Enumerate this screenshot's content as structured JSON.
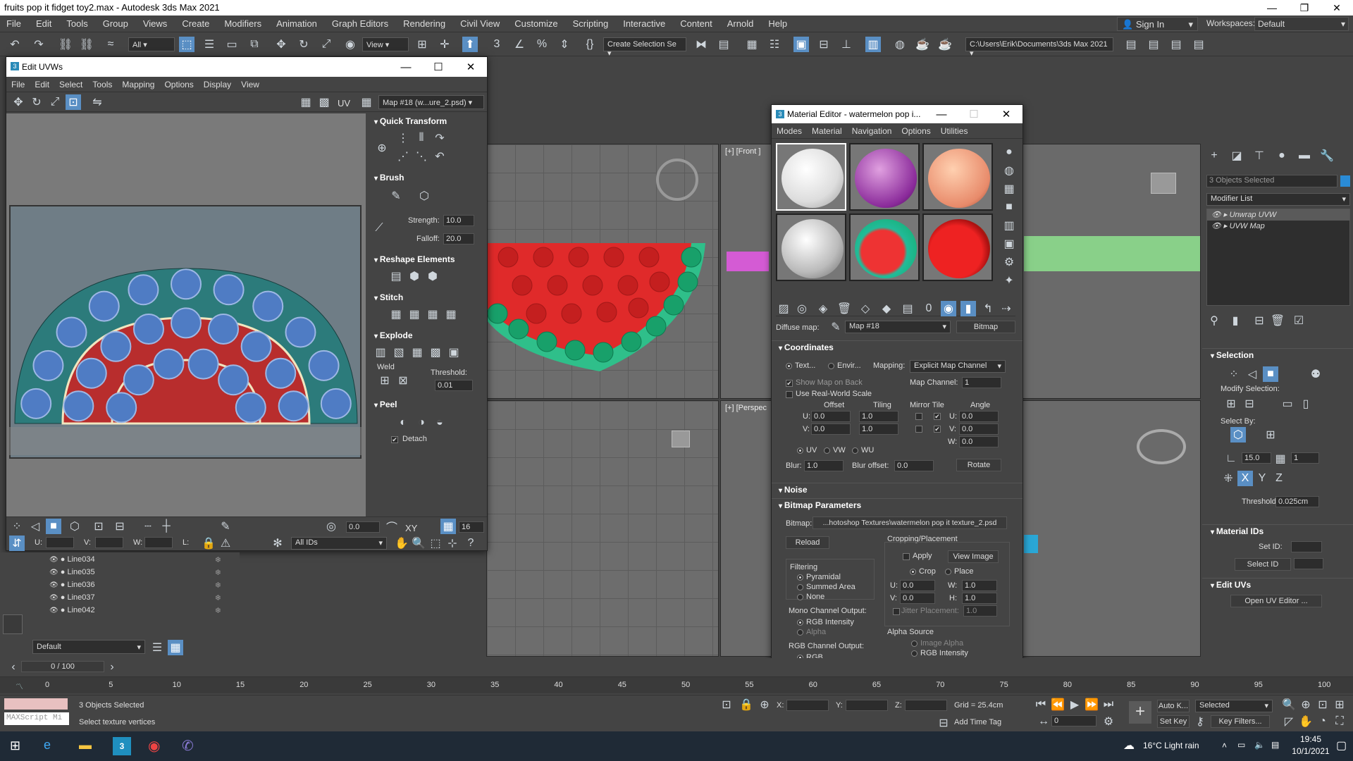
{
  "window": {
    "title": "fruits pop it fidget toy2.max - Autodesk 3ds Max 2021"
  },
  "menus": [
    "File",
    "Edit",
    "Tools",
    "Group",
    "Views",
    "Create",
    "Modifiers",
    "Animation",
    "Graph Editors",
    "Rendering",
    "Civil View",
    "Customize",
    "Scripting",
    "Interactive",
    "Content",
    "Arnold",
    "Help"
  ],
  "account": {
    "sign_in": "Sign In",
    "workspaces_label": "Workspaces:",
    "workspace": "Default"
  },
  "toolbar": {
    "filter": "All",
    "view": "View",
    "selection_set": "Create Selection Se",
    "project_path": "C:\\Users\\Erik\\Documents\\3ds Max 2021"
  },
  "viewports": {
    "front_label": "[+] [Front ]",
    "persp_label": "[+] [Perspec"
  },
  "uv_editor": {
    "title": "Edit UVWs",
    "menu": [
      "File",
      "Edit",
      "Select",
      "Tools",
      "Mapping",
      "Options",
      "Display",
      "View"
    ],
    "uv_label": "UV",
    "map": "Map #18 (w...ure_2.psd)",
    "rollouts": {
      "quick_transform": "Quick Transform",
      "brush": "Brush",
      "strength_label": "Strength:",
      "strength": "10.0",
      "falloff_label": "Falloff:",
      "falloff": "20.0",
      "reshape": "Reshape Elements",
      "stitch": "Stitch",
      "explode": "Explode",
      "weld": "Weld",
      "threshold_label": "Threshold:",
      "threshold": "0.01",
      "peel": "Peel",
      "detach": "Detach"
    },
    "bottom": {
      "rot": "0.0",
      "xy": "XY",
      "px": "16",
      "u": "U:",
      "v": "V:",
      "w": "W:",
      "l": "L:",
      "ids": "All IDs"
    }
  },
  "scene_explorer": {
    "items": [
      "Line034",
      "Line035",
      "Line036",
      "Line037",
      "Line042"
    ],
    "layer": "Default"
  },
  "material_editor": {
    "title": "Material Editor - watermelon pop i...",
    "menu": [
      "Modes",
      "Material",
      "Navigation",
      "Options",
      "Utilities"
    ],
    "diffuse_label": "Diffuse map:",
    "map_name": "Map #18",
    "map_type": "Bitmap",
    "coordinates": {
      "head": "Coordinates",
      "texture": "Text...",
      "environ": "Envir...",
      "mapping_label": "Mapping:",
      "mapping": "Explicit Map Channel",
      "show_map": "Show Map on Back",
      "map_channel_label": "Map Channel:",
      "map_channel": "1",
      "real_world": "Use Real-World Scale",
      "offset": "Offset",
      "tiling": "Tiling",
      "mirror_tile": "Mirror Tile",
      "angle": "Angle",
      "u_off": "0.0",
      "v_off": "0.0",
      "u_tile": "1.0",
      "v_tile": "1.0",
      "u_angle": "0.0",
      "v_angle": "0.0",
      "w_angle": "0.0",
      "uv": "UV",
      "vw": "VW",
      "wu": "WU",
      "blur_label": "Blur:",
      "blur": "1.0",
      "blur_offset_label": "Blur offset:",
      "blur_offset": "0.0",
      "rotate": "Rotate"
    },
    "noise": "Noise",
    "bitmap_params": {
      "head": "Bitmap Parameters",
      "bitmap_label": "Bitmap:",
      "bitmap_path": "...hotoshop Textures\\watermelon pop it texture_2.psd",
      "reload": "Reload",
      "cropping": "Cropping/Placement",
      "apply": "Apply",
      "view_image": "View Image",
      "crop": "Crop",
      "place": "Place",
      "u": "0.0",
      "v": "0.0",
      "w": "1.0",
      "h": "1.0",
      "jitter": "Jitter Placement:",
      "jitter_val": "1.0",
      "filtering": "Filtering",
      "pyramidal": "Pyramidal",
      "summed": "Summed Area",
      "none": "None",
      "mono": "Mono Channel Output:",
      "rgb_int": "RGB Intensity",
      "alpha": "Alpha",
      "rgb_out": "RGB Channel Output:",
      "rgb": "RGB",
      "alpha_src": "Alpha Source",
      "image_alpha": "Image Alpha",
      "alpha_rgb": "RGB Intensity"
    }
  },
  "command_panel": {
    "selected": "3 Objects Selected",
    "modifier_list": "Modifier List",
    "stack": [
      "Unwrap UVW",
      "UVW Map"
    ],
    "selection": "Selection",
    "modify_selection": "Modify Selection:",
    "select_by": "Select By:",
    "angle_val": "15.0",
    "count_val": "1",
    "threshold_label": "Threshold:",
    "threshold": "0.025cm",
    "material_ids": "Material IDs",
    "set_id": "Set ID:",
    "select_id": "Select ID",
    "edit_uvs": "Edit UVs",
    "open_uv": "Open UV Editor ..."
  },
  "timeline": {
    "frame": "0 / 100",
    "ticks": [
      "0",
      "5",
      "10",
      "15",
      "20",
      "25",
      "30",
      "35",
      "40",
      "45",
      "50",
      "55",
      "60",
      "65",
      "70",
      "75",
      "80",
      "85",
      "90",
      "95",
      "100"
    ]
  },
  "status": {
    "selected": "3 Objects Selected",
    "prompt": "Select texture vertices",
    "maxscript": "MAXScript Mi",
    "x": "X:",
    "y": "Y:",
    "z": "Z:",
    "grid": "Grid = 25.4cm",
    "add_time_tag": "Add Time Tag",
    "autokey": "Auto K...",
    "selected_dd": "Selected",
    "setkey": "Set Key",
    "key_filters": "Key Filters...",
    "frame": "0"
  },
  "taskbar": {
    "weather": "16°C  Light rain",
    "time": "19:45",
    "date": "10/1/2021"
  }
}
